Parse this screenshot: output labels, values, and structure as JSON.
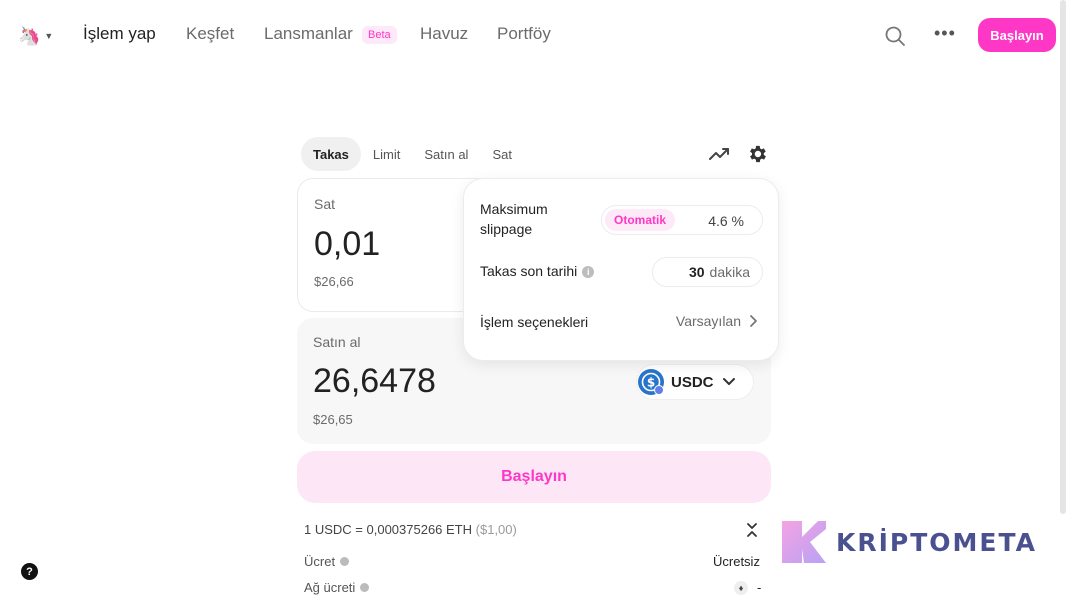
{
  "nav": {
    "logo_icon": "uniswap-unicorn-icon",
    "items": [
      {
        "label": "İşlem yap",
        "active": true
      },
      {
        "label": "Keşfet"
      },
      {
        "label": "Lansmanlar"
      },
      {
        "label": "Havuz"
      },
      {
        "label": "Portföy"
      }
    ],
    "beta_badge": "Beta",
    "cta": "Başlayın"
  },
  "swap": {
    "tabs": [
      "Takas",
      "Limit",
      "Satın al",
      "Sat"
    ],
    "sell": {
      "label": "Sat",
      "amount": "0,01",
      "usd": "$26,66"
    },
    "buy": {
      "label": "Satın al",
      "amount": "26,6478",
      "usd": "$26,65",
      "token": "USDC"
    },
    "button": "Başlayın"
  },
  "details": {
    "rate_main": "1 USDC = 0,000375266 ETH",
    "rate_usd": "($1,00)",
    "fee_label": "Ücret",
    "fee_value": "Ücretsiz",
    "network_fee_label": "Ağ ücreti",
    "network_fee_value": "-"
  },
  "settings": {
    "slippage_label_1": "Maksimum",
    "slippage_label_2": "slippage",
    "slippage_mode": "Otomatik",
    "slippage_value": "4.6 %",
    "deadline_label": "Takas son tarihi",
    "deadline_value": "30",
    "deadline_unit": "dakika",
    "options_label": "İşlem seçenekleri",
    "options_value": "Varsayılan"
  },
  "help": "?",
  "watermark": "KRİPTOMETA",
  "colors": {
    "accent": "#ff37c7",
    "accent_soft": "#fde7f7",
    "watermark": "#4a5190"
  }
}
